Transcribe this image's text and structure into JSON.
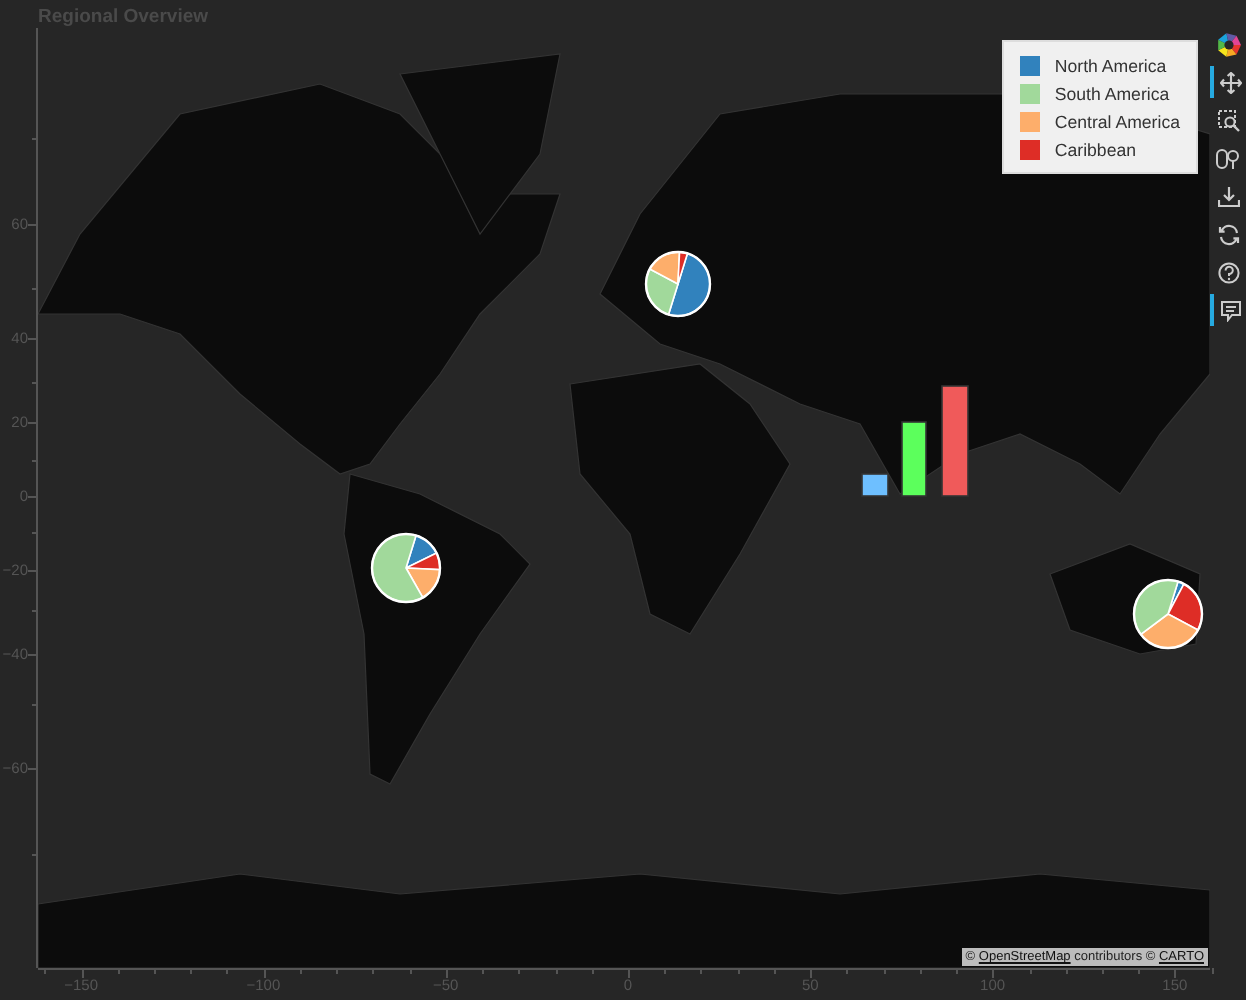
{
  "title": "Regional Overview",
  "legend": [
    {
      "label": "North America",
      "color": "#3182bd"
    },
    {
      "label": "South America",
      "color": "#a1d99b"
    },
    {
      "label": "Central America",
      "color": "#fdae6b"
    },
    {
      "label": "Caribbean",
      "color": "#de2d26"
    }
  ],
  "toolbar": [
    {
      "kind": "logo"
    },
    {
      "kind": "pan",
      "selected": true
    },
    {
      "kind": "box_zoom",
      "selected": false
    },
    {
      "kind": "wheel_zoom",
      "selected": false
    },
    {
      "kind": "save",
      "selected": false
    },
    {
      "kind": "reset",
      "selected": false
    },
    {
      "kind": "help",
      "selected": false
    },
    {
      "kind": "hover",
      "selected": true
    }
  ],
  "y_axis": {
    "ticks": [
      "60",
      "40",
      "20",
      "0",
      "−20",
      "−40",
      "−60"
    ]
  },
  "x_axis": {
    "ticks": [
      "−150",
      "−100",
      "−50",
      "0",
      "50",
      "100",
      "150"
    ]
  },
  "attribution": {
    "prefix": "©",
    "link_1": "OpenStreetMap",
    "middle": "contributors ©",
    "link_2": "CARTO"
  }
}
